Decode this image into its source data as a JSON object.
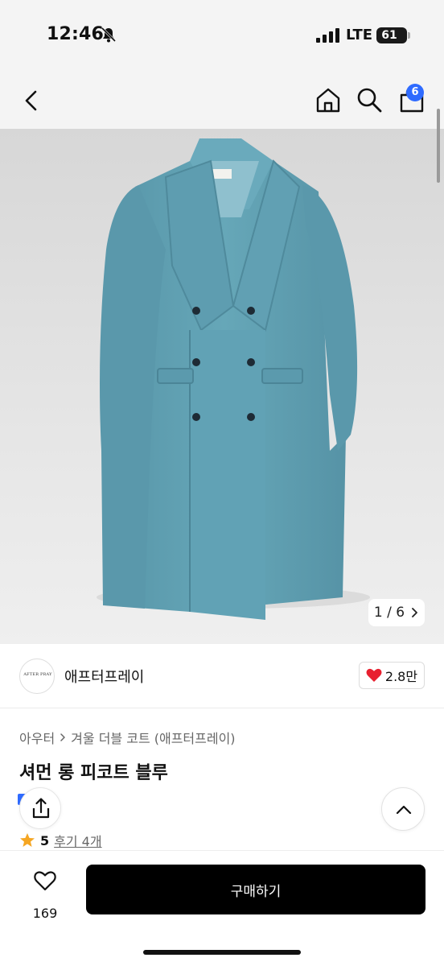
{
  "status_bar": {
    "time": "12:46",
    "network": "LTE",
    "battery": "61"
  },
  "header": {
    "cart_count": "6"
  },
  "gallery": {
    "current": "1",
    "separator": "/",
    "total": "6"
  },
  "brand": {
    "logo_text": "AFTER PRAY",
    "name": "애프터프레이",
    "likes": "2.8만"
  },
  "product": {
    "breadcrumb": [
      "아우터",
      "겨울 더블 코트 (애프터프레이)"
    ],
    "title": "셔먼 롱 피코트 블루",
    "rating": "5",
    "reviews": "후기 4개"
  },
  "bottom": {
    "wish_count": "169",
    "buy_label": "구매하기"
  },
  "colors": {
    "coat": "#5f9fb0",
    "accent": "#2f6bff",
    "heart": "#e8202f",
    "buy_bg": "#000000"
  }
}
